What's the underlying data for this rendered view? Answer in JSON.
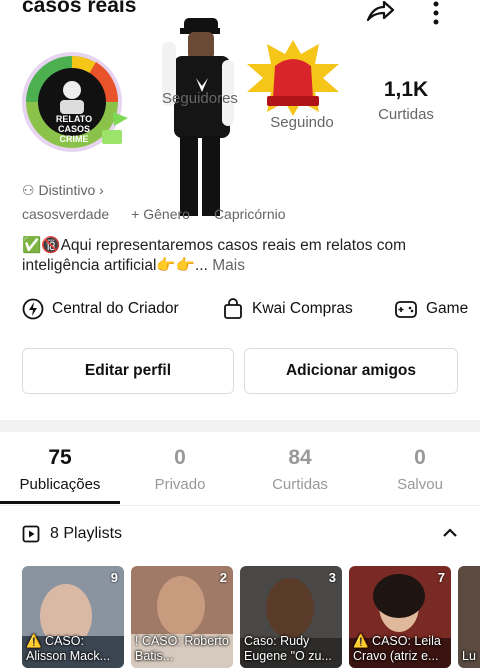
{
  "header": {
    "title": "casos reais"
  },
  "stats": [
    {
      "value": "",
      "label": "Seguidores"
    },
    {
      "value": "",
      "label": "Seguindo"
    },
    {
      "value": "1,1K",
      "label": "Curtidas"
    }
  ],
  "profile": {
    "badge": "Distintivo",
    "username": "casosverdade",
    "add_more": "+ Gênero",
    "sign": "Capricórnio",
    "bio_text": "✅🔞Aqui representaremos casos reais em relatos com inteligência artificial👉👉...",
    "bio_more": "Mais",
    "avatar_text": "RELATO CASOS CRIME"
  },
  "tools": [
    {
      "label": "Central do Criador",
      "icon": "bolt-icon"
    },
    {
      "label": "Kwai Compras",
      "icon": "shopping-bag-icon"
    },
    {
      "label": "Game",
      "icon": "gamepad-icon"
    }
  ],
  "buttons": {
    "edit": "Editar perfil",
    "add_friends": "Adicionar amigos"
  },
  "tabs": [
    {
      "count": "75",
      "label": "Publicações"
    },
    {
      "count": "0",
      "label": "Privado"
    },
    {
      "count": "84",
      "label": "Curtidas"
    },
    {
      "count": "0",
      "label": "Salvou"
    }
  ],
  "playlists": {
    "label": "8 Playlists",
    "items": [
      {
        "count": "9",
        "caption": "⚠️ CASO: Alisson Mack...",
        "color": "#8a94a0"
      },
      {
        "count": "2",
        "caption": "! CASO: Roberto Batis...",
        "color": "#a07a66"
      },
      {
        "count": "3",
        "caption": "Caso: Rudy Eugene \"O zu...",
        "color": "#4a4846"
      },
      {
        "count": "7",
        "caption": "⚠️ CASO: Leila Cravo (atriz e...",
        "color": "#7a2a24"
      },
      {
        "count": "",
        "caption": "Lu",
        "color": "#5a4a40"
      }
    ]
  },
  "colors": {
    "accent": "#111111",
    "muted": "#666666",
    "siren_red": "#d8242a",
    "siren_glow": "#f5c518"
  }
}
